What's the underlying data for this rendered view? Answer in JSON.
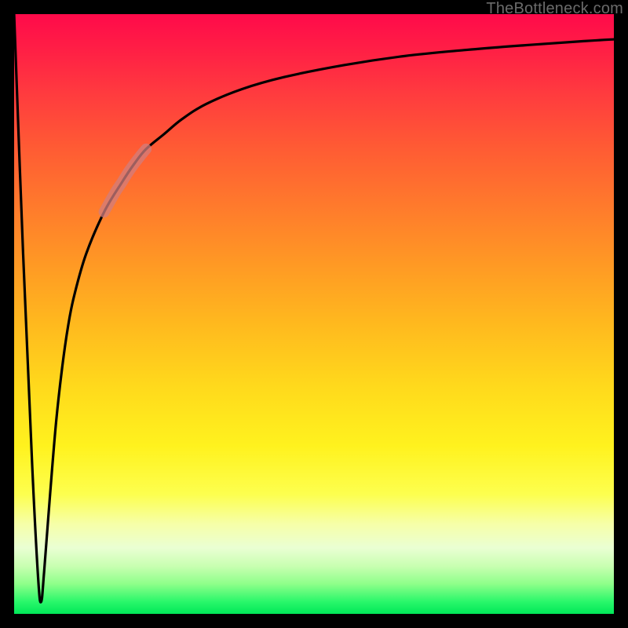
{
  "attribution": "TheBottleneck.com",
  "colors": {
    "frame": "#000000",
    "curve_stroke": "#000000",
    "highlight_stroke": "rgba(210,125,125,0.75)",
    "gradient_top": "#ff0a4a",
    "gradient_bottom": "#00e858"
  },
  "chart_data": {
    "type": "line",
    "title": "",
    "xlabel": "",
    "ylabel": "",
    "xlim": [
      0,
      100
    ],
    "ylim": [
      0,
      100
    ],
    "grid": false,
    "legend": false,
    "annotations": [],
    "series": [
      {
        "name": "bottleneck-curve",
        "x": [
          0,
          1.5,
          3,
          4,
          4.5,
          5,
          6,
          7,
          8,
          9,
          10,
          12,
          15,
          18,
          20,
          22,
          25,
          28,
          32,
          38,
          45,
          55,
          65,
          75,
          85,
          95,
          100
        ],
        "values": [
          100,
          60,
          25,
          6,
          2,
          7,
          20,
          32,
          41,
          48,
          53,
          60,
          67,
          72,
          75,
          77.5,
          80,
          82.5,
          85,
          87.5,
          89.5,
          91.5,
          93,
          94,
          94.8,
          95.5,
          95.8
        ]
      },
      {
        "name": "highlight-segment",
        "x": [
          15,
          16,
          17,
          18,
          19,
          20,
          21,
          22
        ],
        "values": [
          67,
          68.8,
          70.5,
          72,
          73.6,
          75,
          76.3,
          77.5
        ]
      }
    ]
  }
}
